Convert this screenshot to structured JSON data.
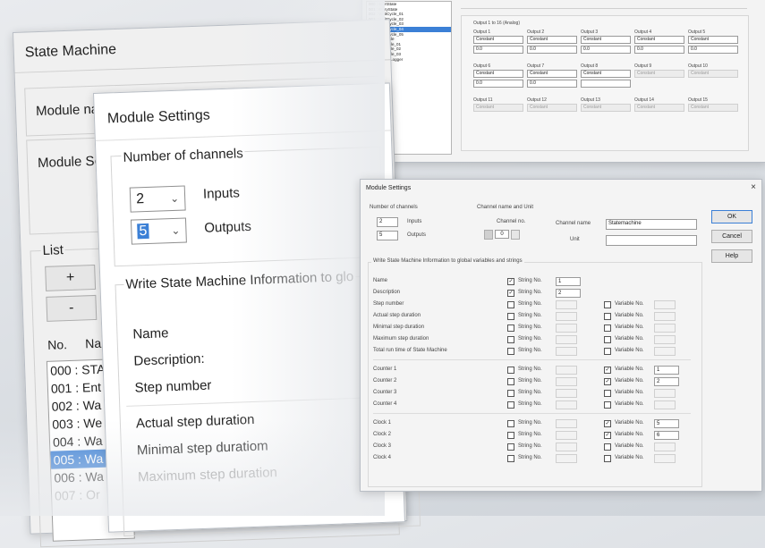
{
  "state_machine": {
    "title": "State Machine",
    "module_name_label": "Module na",
    "module_settings_label": "Module Se",
    "list_label": "List",
    "add_label": "+",
    "remove_label": "-",
    "col_no": "No.",
    "col_name": "Na",
    "items": [
      "000 : STA",
      "001 : Ent",
      "002 : Wa",
      "003 : We",
      "004 : Wa",
      "005 : Wa",
      "006 : Wa",
      "007 : Or"
    ]
  },
  "zoom_dialog": {
    "title": "Module Settings",
    "channels_label": "Number of channels",
    "inputs_value": "2",
    "inputs_label": "Inputs",
    "outputs_value": "5",
    "outputs_label": "Outputs",
    "write_label": "Write State Machine Information to glo",
    "rows": [
      "Name",
      "Description:",
      "Step number",
      "Actual step duration",
      "Minimal step duratiom",
      "Maximum step duration"
    ]
  },
  "top_window": {
    "list_items": [
      "000 : StartState",
      "001 : EntryState",
      "002 : WaitCycle_01",
      "003 : WaitCycle_02",
      "004 : WaitCycle_03",
      "005 : WaitCycle_04",
      "006 : WaitCycle_05",
      "007 : OnCycle",
      "008 : OnCycle_01",
      "009 : OnCycle_02",
      "010 : OnCycle_03",
      "011 : SwitchLogger",
      "012 : Exit"
    ],
    "group_label": "Output 1 to 16 (Analog)",
    "outputs": [
      {
        "label": "Output 1",
        "select": "Constant",
        "value": "0.0",
        "enabled": true
      },
      {
        "label": "Output 2",
        "select": "Constant",
        "value": "0.0",
        "enabled": true
      },
      {
        "label": "Output 3",
        "select": "Constant",
        "value": "0.0",
        "enabled": true
      },
      {
        "label": "Output 4",
        "select": "Constant",
        "value": "0.0",
        "enabled": true
      },
      {
        "label": "Output 5",
        "select": "Constant",
        "value": "0.0",
        "enabled": true
      },
      {
        "label": "Output 6",
        "select": "Constant",
        "value": "0.0",
        "enabled": true
      },
      {
        "label": "Output 7",
        "select": "Constant",
        "value": "0.0",
        "enabled": true
      },
      {
        "label": "Output 8",
        "select": "Constant",
        "value": "",
        "enabled": true
      },
      {
        "label": "Output 9",
        "select": "Constant",
        "value": "",
        "enabled": false
      },
      {
        "label": "Output 10",
        "select": "Constant",
        "value": "",
        "enabled": false
      },
      {
        "label": "Output 11",
        "select": "Constant",
        "value": "",
        "enabled": false
      },
      {
        "label": "Output 12",
        "select": "Constant",
        "value": "",
        "enabled": false
      },
      {
        "label": "Output 13",
        "select": "Constant",
        "value": "",
        "enabled": false
      },
      {
        "label": "Output 14",
        "select": "Constant",
        "value": "",
        "enabled": false
      },
      {
        "label": "Output 15",
        "select": "Constant",
        "value": "",
        "enabled": false
      }
    ]
  },
  "dialog": {
    "title": "Module Settings",
    "close_glyph": "×",
    "channels_label": "Number of channels",
    "inputs_value": "2",
    "inputs_label": "Inputs",
    "outputs_value": "5",
    "outputs_label": "Outputs",
    "channel_group_label": "Channel name and Unit",
    "channel_no_label": "Channel no.",
    "channel_no_value": "0",
    "channel_name_label": "Channel name",
    "channel_name_value": "Statemachine",
    "unit_label": "Unit",
    "unit_value": "",
    "ok_label": "OK",
    "cancel_label": "Cancel",
    "help_label": "Help",
    "write_label": "Write State Machine Information to global variables and strings",
    "string_no_label": "String No.",
    "variable_no_label": "Variable No.",
    "rows": [
      {
        "name": "Name",
        "str_checked": true,
        "str_value": "1",
        "has_var": false,
        "var_checked": false,
        "var_value": ""
      },
      {
        "name": "Description",
        "str_checked": true,
        "str_value": "2",
        "has_var": false,
        "var_checked": false,
        "var_value": ""
      },
      {
        "name": "Step number",
        "str_checked": false,
        "str_value": "",
        "has_var": true,
        "var_checked": false,
        "var_value": ""
      },
      {
        "name": "Actual step duration",
        "str_checked": false,
        "str_value": "",
        "has_var": true,
        "var_checked": false,
        "var_value": ""
      },
      {
        "name": "Minimal step duration",
        "str_checked": false,
        "str_value": "",
        "has_var": true,
        "var_checked": false,
        "var_value": ""
      },
      {
        "name": "Maximum step duration",
        "str_checked": false,
        "str_value": "",
        "has_var": true,
        "var_checked": false,
        "var_value": ""
      },
      {
        "name": "Total run time of State Machine",
        "str_checked": false,
        "str_value": "",
        "has_var": true,
        "var_checked": false,
        "var_value": ""
      },
      {
        "name": "Counter 1",
        "str_checked": false,
        "str_value": "",
        "has_var": true,
        "var_checked": true,
        "var_value": "1"
      },
      {
        "name": "Counter 2",
        "str_checked": false,
        "str_value": "",
        "has_var": true,
        "var_checked": true,
        "var_value": "2"
      },
      {
        "name": "Counter 3",
        "str_checked": false,
        "str_value": "",
        "has_var": true,
        "var_checked": false,
        "var_value": ""
      },
      {
        "name": "Counter 4",
        "str_checked": false,
        "str_value": "",
        "has_var": true,
        "var_checked": false,
        "var_value": ""
      },
      {
        "name": "Clock 1",
        "str_checked": false,
        "str_value": "",
        "has_var": true,
        "var_checked": true,
        "var_value": "5"
      },
      {
        "name": "Clock 2",
        "str_checked": false,
        "str_value": "",
        "has_var": true,
        "var_checked": true,
        "var_value": "6"
      },
      {
        "name": "Clock 3",
        "str_checked": false,
        "str_value": "",
        "has_var": true,
        "var_checked": false,
        "var_value": ""
      },
      {
        "name": "Clock 4",
        "str_checked": false,
        "str_value": "",
        "has_var": true,
        "var_checked": false,
        "var_value": ""
      }
    ]
  }
}
